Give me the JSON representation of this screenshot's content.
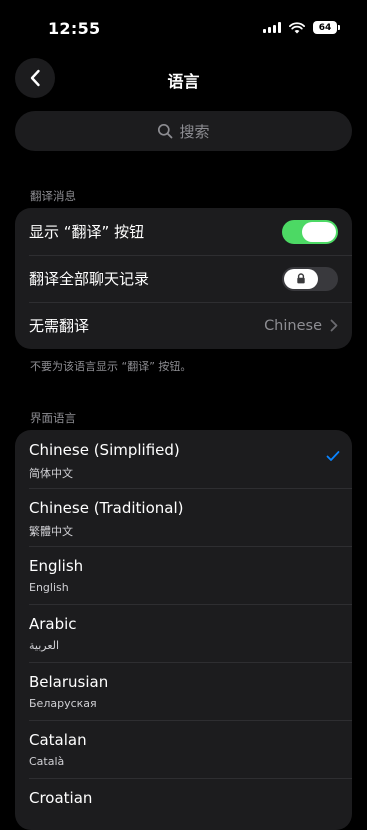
{
  "status_bar": {
    "time": "12:55",
    "battery": "64"
  },
  "nav": {
    "title": "语言"
  },
  "search": {
    "placeholder": "搜索"
  },
  "translate_section": {
    "label": "翻译消息",
    "rows": [
      {
        "label": "显示 “翻译” 按钮",
        "toggle": true
      },
      {
        "label": "翻译全部聊天记录",
        "toggle": false,
        "locked": true
      },
      {
        "label": "无需翻译",
        "value": "Chinese"
      }
    ],
    "footnote": "不要为该语言显示 “翻译” 按钮。"
  },
  "interface_section": {
    "label": "界面语言",
    "languages": [
      {
        "name": "Chinese (Simplified)",
        "native": "简体中文",
        "selected": true
      },
      {
        "name": "Chinese (Traditional)",
        "native": "繁體中文"
      },
      {
        "name": "English",
        "native": "English"
      },
      {
        "name": "Arabic",
        "native": "العربية"
      },
      {
        "name": "Belarusian",
        "native": "Беларуская"
      },
      {
        "name": "Catalan",
        "native": "Català"
      },
      {
        "name": "Croatian",
        "native": ""
      }
    ]
  },
  "colors": {
    "accent": "#4cd964",
    "check": "#0a84ff",
    "background": "#000000",
    "group": "#1c1c1e"
  }
}
